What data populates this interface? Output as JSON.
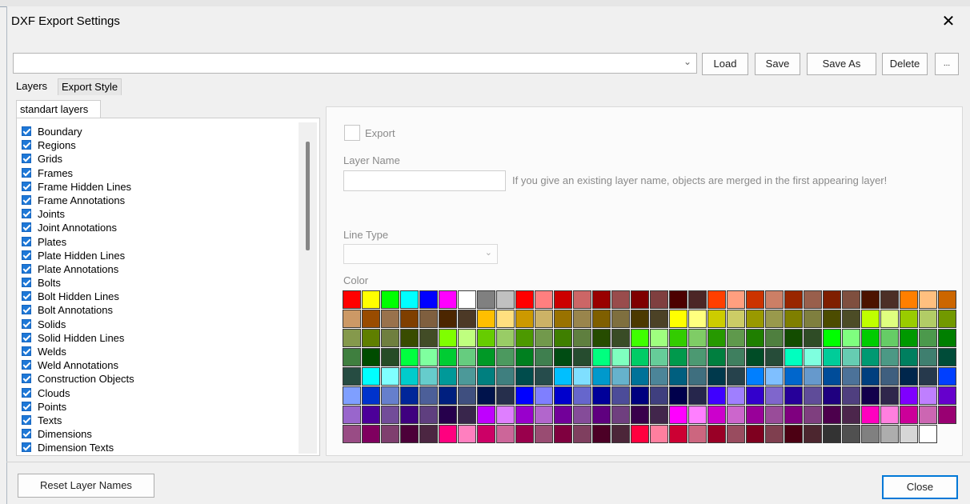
{
  "window": {
    "title": "DXF Export Settings",
    "close_glyph": "✕"
  },
  "toolbar": {
    "preset_value": "",
    "load_label": "Load",
    "save_label": "Save",
    "save_as_label": "Save As",
    "delete_label": "Delete",
    "more_label": "..."
  },
  "tabs": {
    "layers": "Layers",
    "export_style": "Export Style"
  },
  "inner_tab": "standart layers",
  "layers": [
    "Boundary",
    "Regions",
    "Grids",
    "Frames",
    "Frame Hidden Lines",
    "Frame Annotations",
    "Joints",
    "Joint Annotations",
    "Plates",
    "Plate Hidden Lines",
    "Plate Annotations",
    "Bolts",
    "Bolt Hidden Lines",
    "Bolt Annotations",
    "Solids",
    "Solid Hidden Lines",
    "Welds",
    "Weld Annotations",
    "Construction Objects",
    "Clouds",
    "Points",
    "Texts",
    "Dimensions",
    "Dimension Texts"
  ],
  "layer_checked": true,
  "props": {
    "export_label": "Export",
    "export_checked": false,
    "layer_name_label": "Layer Name",
    "layer_name_value": "",
    "layer_name_hint": "If you give an existing layer name, objects are merged in the first appearing layer!",
    "line_type_label": "Line Type",
    "line_type_value": "",
    "color_label": "Color"
  },
  "palette": [
    "#FF0000",
    "#FFFF00",
    "#00FF00",
    "#00FFFF",
    "#0000FF",
    "#FF00FF",
    "#FFFFFF",
    "#808080",
    "#C0C0C0",
    "#FF0000",
    "#FF7F7F",
    "#CC0000",
    "#CC6666",
    "#990000",
    "#994C4C",
    "#7F0000",
    "#7F3F3F",
    "#4C0000",
    "#4C2626",
    "#FF3F00",
    "#FF9F7F",
    "#CC3300",
    "#CC7F66",
    "#992600",
    "#995F4C",
    "#7F1F00",
    "#7F4F3F",
    "#4C1300",
    "#4C2F26",
    "#FF7F00",
    "#FFBF7F",
    "#CC6600",
    "#CC9966",
    "#994C00",
    "#99724C",
    "#7F3F00",
    "#7F5F3F",
    "#4C2600",
    "#4C3926",
    "#FFBF00",
    "#FFDF7F",
    "#CC9900",
    "#CCB266",
    "#997200",
    "#99854C",
    "#7F5F00",
    "#7F6F3F",
    "#4C3900",
    "#4C4226",
    "#FFFF00",
    "#FFFF7F",
    "#CCCC00",
    "#CCCC66",
    "#999900",
    "#99994C",
    "#7F7F00",
    "#7F7F3F",
    "#4C4C00",
    "#4C4C26",
    "#BFFF00",
    "#DFFF7F",
    "#99CC00",
    "#B2CC66",
    "#729900",
    "#85994C",
    "#5F7F00",
    "#6F7F3F",
    "#394C00",
    "#424C26",
    "#7FFF00",
    "#BFFF7F",
    "#66CC00",
    "#99CC66",
    "#4C9900",
    "#72994C",
    "#3F7F00",
    "#5F7F3F",
    "#264C00",
    "#394C26",
    "#3FFF00",
    "#9FFF7F",
    "#33CC00",
    "#7FCC66",
    "#269900",
    "#5F994C",
    "#1F7F00",
    "#4F7F3F",
    "#134C00",
    "#2F4C26",
    "#00FF00",
    "#7FFF7F",
    "#00CC00",
    "#66CC66",
    "#009900",
    "#4C994C",
    "#007F00",
    "#3F7F3F",
    "#004C00",
    "#264C26",
    "#00FF3F",
    "#7FFF9F",
    "#00CC33",
    "#66CC7F",
    "#009926",
    "#4C995F",
    "#007F1F",
    "#3F7F4F",
    "#004C13",
    "#264C2F",
    "#00FF7F",
    "#7FFFBF",
    "#00CC66",
    "#66CC99",
    "#00994C",
    "#4C9972",
    "#007F3F",
    "#3F7F5F",
    "#004C26",
    "#264C39",
    "#00FFBF",
    "#7FFFDF",
    "#00CC99",
    "#66CCB2",
    "#009972",
    "#4C9985",
    "#007F5F",
    "#3F7F6F",
    "#004C39",
    "#264C42",
    "#00FFFF",
    "#7FFFFF",
    "#00CCCC",
    "#66CCCC",
    "#009999",
    "#4C9999",
    "#007F7F",
    "#3F7F7F",
    "#004C4C",
    "#264C4C",
    "#00BFFF",
    "#7FDFFF",
    "#0099CC",
    "#66B2CC",
    "#007299",
    "#4C8599",
    "#005F7F",
    "#3F6F7F",
    "#00394C",
    "#26424C",
    "#007FFF",
    "#7FBFFF",
    "#0066CC",
    "#6699CC",
    "#004C99",
    "#4C7299",
    "#003F7F",
    "#3F5F7F",
    "#00264C",
    "#26394C",
    "#003FFF",
    "#7F9FFF",
    "#0033CC",
    "#667FCC",
    "#002699",
    "#4C5F99",
    "#001F7F",
    "#3F4F7F",
    "#00134C",
    "#262F4C",
    "#0000FF",
    "#7F7FFF",
    "#0000CC",
    "#6666CC",
    "#000099",
    "#4C4C99",
    "#00007F",
    "#3F3F7F",
    "#00004C",
    "#26264C",
    "#3F00FF",
    "#9F7FFF",
    "#3300CC",
    "#7F66CC",
    "#260099",
    "#5F4C99",
    "#1F007F",
    "#4F3F7F",
    "#13004C",
    "#2F264C",
    "#7F00FF",
    "#BF7FFF",
    "#6600CC",
    "#9966CC",
    "#4C0099",
    "#724C99",
    "#3F007F",
    "#5F3F7F",
    "#26004C",
    "#39264C",
    "#BF00FF",
    "#DF7FFF",
    "#9900CC",
    "#B266CC",
    "#720099",
    "#854C99",
    "#5F007F",
    "#6F3F7F",
    "#39004C",
    "#42264C",
    "#FF00FF",
    "#FF7FFF",
    "#CC00CC",
    "#CC66CC",
    "#990099",
    "#994C99",
    "#7F007F",
    "#7F3F7F",
    "#4C004C",
    "#4C264C",
    "#FF00BF",
    "#FF7FDF",
    "#CC0099",
    "#CC66B2",
    "#990072",
    "#994C85",
    "#7F005F",
    "#7F3F6F",
    "#4C0039",
    "#4C2642",
    "#FF007F",
    "#FF7FBF",
    "#CC0066",
    "#CC6699",
    "#99004C",
    "#994C72",
    "#7F003F",
    "#7F3F5F",
    "#4C0026",
    "#4C2639",
    "#FF003F",
    "#FF7F9F",
    "#CC0033",
    "#CC667F",
    "#990026",
    "#994C5F",
    "#7F001F",
    "#7F3F4F",
    "#4C0013",
    "#4C262F",
    "#333333",
    "#505050",
    "#808080",
    "#ADADAD",
    "#D6D6D6",
    "#FFFFFF"
  ],
  "footer": {
    "reset_label": "Reset Layer Names",
    "close_label": "Close"
  }
}
